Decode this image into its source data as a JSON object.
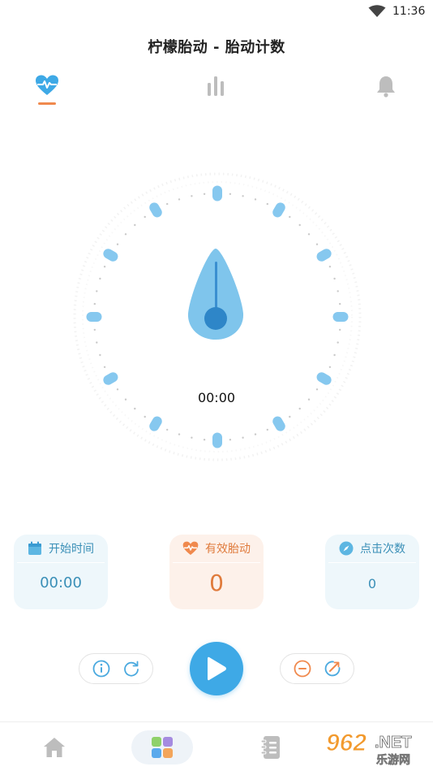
{
  "status_bar": {
    "time": "11:36"
  },
  "header": {
    "title": "柠檬胎动 - 胎动计数"
  },
  "top_tabs": [
    {
      "icon": "heartbeat-icon",
      "active": true
    },
    {
      "icon": "bar-chart-icon",
      "active": false
    },
    {
      "icon": "bell-icon",
      "active": false
    }
  ],
  "timer": {
    "elapsed": "00:00"
  },
  "cards": {
    "start_time": {
      "label": "开始时间",
      "value": "00:00",
      "icon": "calendar-icon"
    },
    "effective_movements": {
      "label": "有效胎动",
      "value": "0",
      "icon": "heartbeat-icon"
    },
    "click_count": {
      "label": "点击次数",
      "value": "0",
      "icon": "compass-icon"
    }
  },
  "controls": {
    "left": [
      "info-icon",
      "refresh-icon"
    ],
    "center": "play-icon",
    "right": [
      "minus-icon",
      "edit-icon"
    ]
  },
  "bottom_nav": [
    {
      "icon": "home-icon",
      "active": false
    },
    {
      "icon": "apps-grid-icon",
      "active": true
    },
    {
      "icon": "notebook-icon",
      "active": false
    }
  ],
  "watermark": {
    "main": "962",
    "suffix": ".NET",
    "sub": "乐游网"
  },
  "colors": {
    "accent_blue": "#3ea9e6",
    "light_blue": "#7fc5ec",
    "accent_orange": "#f0894d",
    "card_blue_bg": "#eef7fb",
    "card_orange_bg": "#fdf1ea"
  }
}
